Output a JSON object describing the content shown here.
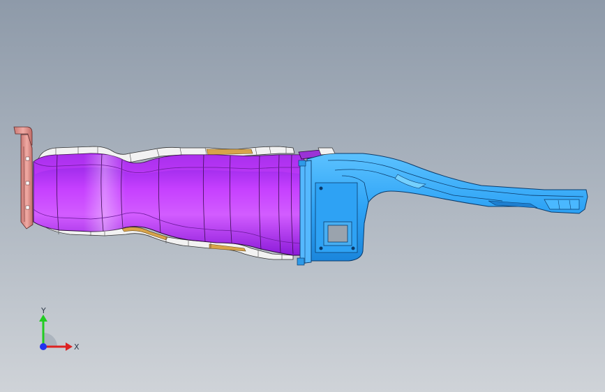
{
  "viewport": {
    "background_top": "#8e9aa9",
    "background_bottom": "#cfd3d8"
  },
  "model": {
    "parts": [
      {
        "name": "tube-body",
        "color": "#b030f0"
      },
      {
        "name": "bracket-body",
        "color": "#33aaff"
      },
      {
        "name": "flange",
        "color": "#e7a09a"
      },
      {
        "name": "reinforcement-strips",
        "color": "#f2f2f2"
      }
    ]
  },
  "triad": {
    "y_label": "Y",
    "x_label": "X",
    "y_color": "#22cc22",
    "x_color": "#dd2222",
    "z_color": "#2233ee"
  }
}
